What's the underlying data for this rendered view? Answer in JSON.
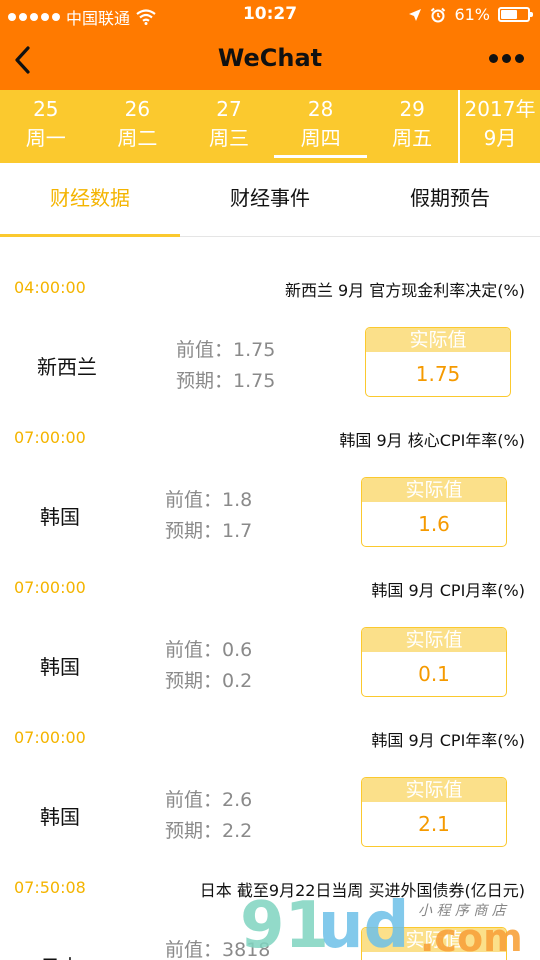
{
  "status": {
    "carrier": "中国联通",
    "time": "10:27",
    "battery": "61%",
    "battery_level": 0.61
  },
  "nav": {
    "title": "WeChat"
  },
  "dates": {
    "days": [
      {
        "num": "25",
        "weekday": "周一"
      },
      {
        "num": "26",
        "weekday": "周二"
      },
      {
        "num": "27",
        "weekday": "周三"
      },
      {
        "num": "28",
        "weekday": "周四",
        "active": true
      },
      {
        "num": "29",
        "weekday": "周五"
      }
    ],
    "year": "2017年",
    "month": "9月"
  },
  "tabs": [
    {
      "label": "财经数据",
      "active": true
    },
    {
      "label": "财经事件"
    },
    {
      "label": "假期预告"
    }
  ],
  "labels": {
    "prev": "前值：",
    "forecast": "预期：",
    "actual": "实际值"
  },
  "entries": [
    {
      "time": "04:00:00",
      "event": "新西兰 9月 官方现金利率决定(%)",
      "country": "新西兰",
      "prev": "1.75",
      "forecast": "1.75",
      "actual": "1.75"
    },
    {
      "time": "07:00:00",
      "event": "韩国 9月 核心CPI年率(%)",
      "country": "韩国",
      "prev": "1.8",
      "forecast": "1.7",
      "actual": "1.6"
    },
    {
      "time": "07:00:00",
      "event": "韩国 9月 CPI月率(%)",
      "country": "韩国",
      "prev": "0.6",
      "forecast": "0.2",
      "actual": "0.1"
    },
    {
      "time": "07:00:00",
      "event": "韩国 9月 CPI年率(%)",
      "country": "韩国",
      "prev": "2.6",
      "forecast": "2.2",
      "actual": "2.1"
    },
    {
      "time": "07:50:08",
      "event": "日本 截至9月22日当周 买进外国债券(亿日元)",
      "country": "日本",
      "prev": "3818",
      "forecast": "",
      "actual": ""
    }
  ],
  "watermark": {
    "brand": "91ud.com",
    "tagline": "小程序商店"
  }
}
